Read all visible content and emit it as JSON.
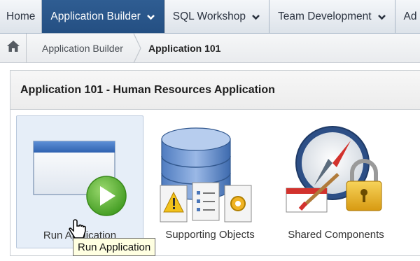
{
  "topnav": {
    "tabs": [
      {
        "label": "Home",
        "active": false,
        "dropdown": false
      },
      {
        "label": "Application Builder",
        "active": true,
        "dropdown": true
      },
      {
        "label": "SQL Workshop",
        "active": false,
        "dropdown": true
      },
      {
        "label": "Team Development",
        "active": false,
        "dropdown": true
      },
      {
        "label": "Ad",
        "active": false,
        "dropdown": false
      }
    ]
  },
  "breadcrumb": {
    "home_icon": "home-icon",
    "items": [
      "Application Builder",
      "Application 101"
    ]
  },
  "panel": {
    "title": "Application 101 - Human Resources Application",
    "tiles": [
      {
        "label": "Run Application",
        "icon": "run-application-icon"
      },
      {
        "label": "Supporting Objects",
        "icon": "supporting-objects-icon"
      },
      {
        "label": "Shared Components",
        "icon": "shared-components-icon"
      }
    ]
  },
  "tooltip": "Run Application",
  "colors": {
    "active_tab": "#2a5689",
    "selected_tile": "#e6eef8",
    "play_green": "#5fb336"
  }
}
